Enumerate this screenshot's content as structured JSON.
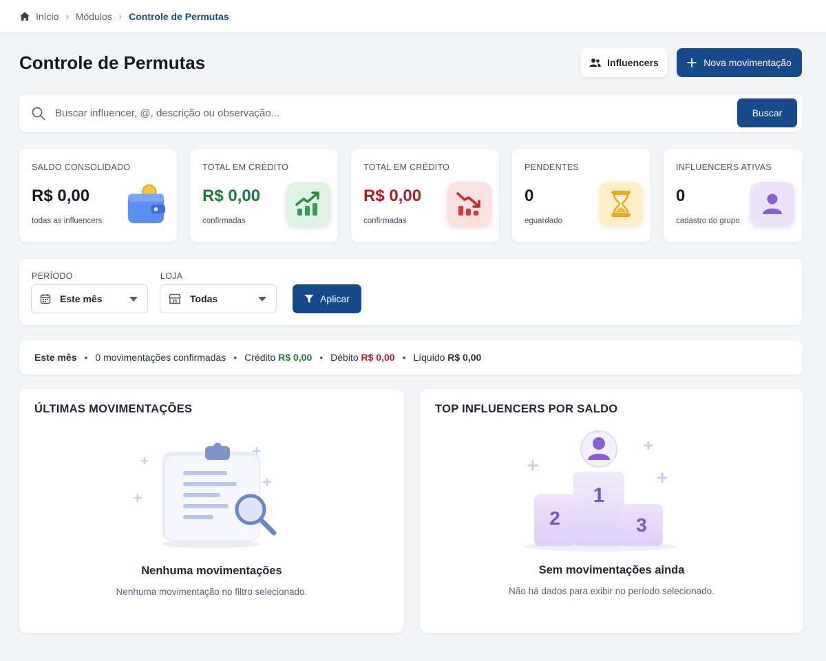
{
  "breadcrumb": {
    "items": [
      "Início",
      "Módulos"
    ],
    "current": "Controle de Permutas"
  },
  "header": {
    "title": "Controle de Permutas",
    "influencers_button": "Influencers",
    "new_button": "Nova movimentação"
  },
  "search": {
    "placeholder": "Buscar influencer, @, descrição ou observação...",
    "button": "Buscar"
  },
  "cards": [
    {
      "label": "SALDO CONSOLIDADO",
      "value": "R$ 0,00",
      "sub": "todas as influencers",
      "icon": "wallet-icon",
      "color": "#141a26"
    },
    {
      "label": "TOTAL EM CRÉDITO",
      "value": "R$ 0,00",
      "sub": "confirmadas",
      "icon": "trend-up-icon",
      "color": "#1f7a39"
    },
    {
      "label": "TOTAL EM CRÉDITO",
      "value": "R$ 0,00",
      "sub": "confirmadas",
      "icon": "trend-down-icon",
      "color": "#b01d22"
    },
    {
      "label": "PENDENTES",
      "value": "0",
      "sub": "eguardado",
      "icon": "hourglass-icon",
      "color": "#141a26"
    },
    {
      "label": "INFLUENCERS ATIVAS",
      "value": "0",
      "sub": "cadastro do grupo",
      "icon": "user-icon",
      "color": "#141a26"
    }
  ],
  "filters": {
    "period_label": "PERÍODO",
    "period_value": "Este mês",
    "store_label": "LOJA",
    "store_value": "Todas",
    "apply_button": "Aplicar"
  },
  "summary": {
    "period": "Este mês",
    "count_text": "0 movimentações confirmadas",
    "credit_label": "Crédito",
    "credit_value": "R$ 0,00",
    "debit_label": "Débito",
    "debit_value": "R$ 0,00",
    "net_label": "Líquido",
    "net_value": "R$ 0,00"
  },
  "panels": {
    "latest": {
      "title": "ÚLTIMAS MOVIMENTAÇÕES",
      "empty_title": "Nenhuma movimentações",
      "empty_text": "Nenhuma movimentação no filtro selecionado."
    },
    "top": {
      "title": "TOP INFLUENCERS POR SALDO",
      "empty_title": "Sem movimentações ainda",
      "empty_text": "Não há dados para exibir no período selecionado.",
      "podium": [
        "1",
        "2",
        "3"
      ]
    }
  },
  "colors": {
    "primary": "#174a8b",
    "credit": "#1f7a39",
    "debit": "#b01d22"
  }
}
